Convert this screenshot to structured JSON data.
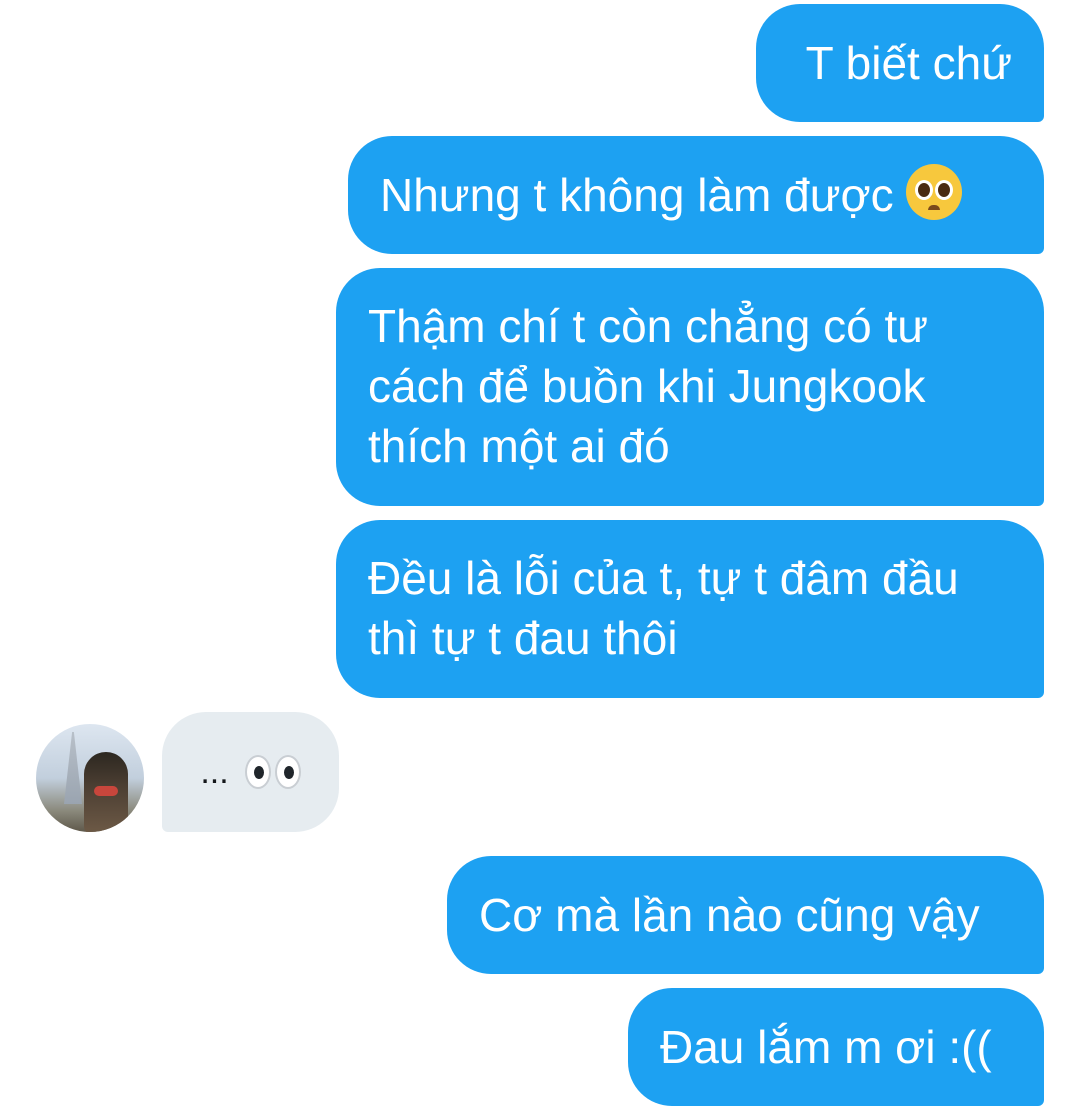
{
  "conversation": {
    "accent_color": "#1da1f2",
    "incoming_bubble_color": "#e6ecf0",
    "messages": [
      {
        "sender": "me",
        "text": "T biết chứ"
      },
      {
        "sender": "me",
        "text": "Nhưng t không làm được",
        "emoji": "pleading-face-emoji"
      },
      {
        "sender": "me",
        "text": "Thậm chí t còn chẳng có tư cách để buồn khi Jungkook thích một ai đó"
      },
      {
        "sender": "me",
        "text": "Đều là lỗi của t, tự t đâm đầu thì tự t đau thôi"
      },
      {
        "sender": "other",
        "text": "...",
        "emoji": "eyes-emoji",
        "avatar": "user-avatar"
      },
      {
        "sender": "me",
        "text": "Cơ mà lần nào cũng vậy"
      },
      {
        "sender": "me",
        "text": "Đau lắm m ơi :(("
      }
    ]
  }
}
